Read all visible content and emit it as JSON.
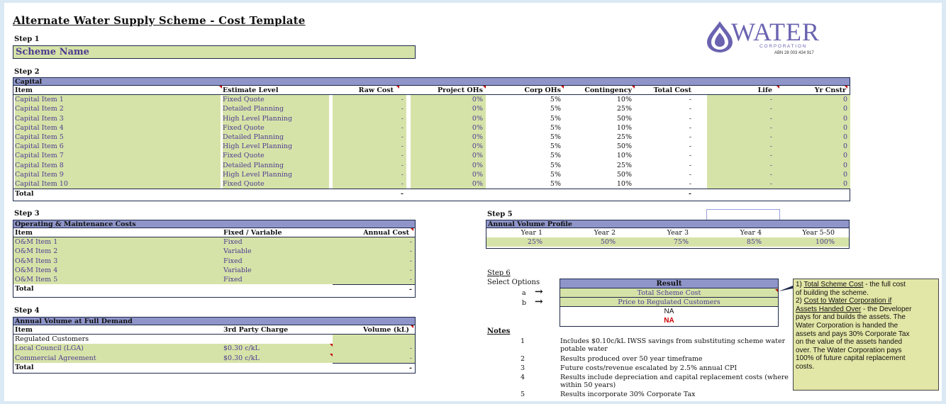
{
  "title": "Alternate Water Supply Scheme - Cost Template",
  "step1": {
    "label": "Step 1",
    "scheme_name": "Scheme Name"
  },
  "logo": {
    "word": "WATER",
    "sub": "C O R P O R A T I O N",
    "abn": "ABN 28 003 434 917"
  },
  "step2": {
    "label": "Step 2",
    "section": "Capital",
    "headers": [
      "Item",
      "Estimate Level",
      "Raw Cost",
      "Project OHs",
      "Corp OHs",
      "Contingency",
      "Total Cost",
      "Life",
      "Yr Cnstr"
    ],
    "rows": [
      [
        "Capital Item 1",
        "Fixed Quote",
        "-",
        "0%",
        "5%",
        "10%",
        "-",
        "-",
        "0"
      ],
      [
        "Capital Item 2",
        "Detailed Planning",
        "-",
        "0%",
        "5%",
        "25%",
        "-",
        "-",
        "0"
      ],
      [
        "Capital Item 3",
        "High Level Planning",
        "-",
        "0%",
        "5%",
        "50%",
        "-",
        "-",
        "0"
      ],
      [
        "Capital Item 4",
        "Fixed Quote",
        "-",
        "0%",
        "5%",
        "10%",
        "-",
        "-",
        "0"
      ],
      [
        "Capital Item 5",
        "Detailed Planning",
        "-",
        "0%",
        "5%",
        "25%",
        "-",
        "-",
        "0"
      ],
      [
        "Capital Item 6",
        "High Level Planning",
        "-",
        "0%",
        "5%",
        "50%",
        "-",
        "-",
        "0"
      ],
      [
        "Capital Item 7",
        "Fixed Quote",
        "-",
        "0%",
        "5%",
        "10%",
        "-",
        "-",
        "0"
      ],
      [
        "Capital Item 8",
        "Detailed Planning",
        "-",
        "0%",
        "5%",
        "25%",
        "-",
        "-",
        "0"
      ],
      [
        "Capital Item 9",
        "High Level Planning",
        "-",
        "0%",
        "5%",
        "50%",
        "-",
        "-",
        "0"
      ],
      [
        "Capital Item 10",
        "Fixed Quote",
        "-",
        "0%",
        "5%",
        "10%",
        "-",
        "-",
        "0"
      ]
    ],
    "total": {
      "label": "Total",
      "raw": "-",
      "total_cost": "-"
    }
  },
  "step3": {
    "label": "Step 3",
    "section": "Operating & Maintenance Costs",
    "headers": [
      "Item",
      "Fixed / Variable",
      "Annual Cost"
    ],
    "rows": [
      [
        "O&M Item 1",
        "Fixed",
        "-"
      ],
      [
        "O&M Item 2",
        "Variable",
        "-"
      ],
      [
        "O&M Item 3",
        "Fixed",
        "-"
      ],
      [
        "O&M Item 4",
        "Variable",
        "-"
      ],
      [
        "O&M Item 5",
        "Fixed",
        "-"
      ]
    ],
    "total": {
      "label": "Total",
      "value": "-"
    }
  },
  "step4": {
    "label": "Step 4",
    "section": "Annual Volume at Full Demand",
    "headers": [
      "Item",
      "3rd Party Charge",
      "Volume (kL)"
    ],
    "rows": [
      [
        "Regulated Customers",
        "",
        ""
      ],
      [
        "Local Council (LGA)",
        "$0.30 c/kL",
        "-"
      ],
      [
        "Commercial Agreement",
        "$0.30 c/kL",
        "-"
      ]
    ],
    "total": {
      "label": "Total",
      "value": "-"
    }
  },
  "step5": {
    "label": "Step 5",
    "section": "Annual Volume Profile",
    "years": [
      "Year 1",
      "Year 2",
      "Year 3",
      "Year 4",
      "Year 5-50"
    ],
    "values": [
      "25%",
      "50%",
      "75%",
      "85%",
      "100%"
    ]
  },
  "step6": {
    "label": "Step 6",
    "select": "Select Options",
    "opt_a": "a",
    "opt_b": "b",
    "arrow": "→",
    "result_header": "Result",
    "result_a": "Total Scheme Cost",
    "result_b": "Price to Regulated Customers",
    "na1": "NA",
    "na2": "NA"
  },
  "notes": {
    "label": "Notes",
    "items": [
      {
        "n": "1",
        "lines": [
          "Includes $0.10c/kL IWSS savings from substituting scheme water",
          "potable water"
        ]
      },
      {
        "n": "2",
        "lines": [
          "Results produced over 50 year timeframe"
        ]
      },
      {
        "n": "3",
        "lines": [
          "Future costs/revenue escalated by 2.5% annual CPI"
        ]
      },
      {
        "n": "4",
        "lines": [
          "Results include depreciation and capital replacement costs (where",
          "within 50 years)"
        ]
      },
      {
        "n": "5",
        "lines": [
          "Results incorporate 30% Corporate Tax"
        ]
      }
    ]
  },
  "comment": {
    "lines": [
      "1)  Total Scheme Cost - the full cost",
      "of building the scheme.",
      "2)  Cost to Water Corporation if",
      "Assets Handed Over - the Developer",
      "pays for and builds the assets.  The",
      "Water Corporation is handed the",
      "assets and pays 30% Corporate Tax",
      "on the value of the assets handed",
      "over.  The Water Corporation pays",
      "100% of future capital replacement",
      "costs."
    ]
  },
  "colors": {
    "header": "#8f95c9",
    "input": "#d6e3a8",
    "text_input": "#4b3b91",
    "na_red": "#cc0000",
    "bg": "#dbe9f4"
  }
}
